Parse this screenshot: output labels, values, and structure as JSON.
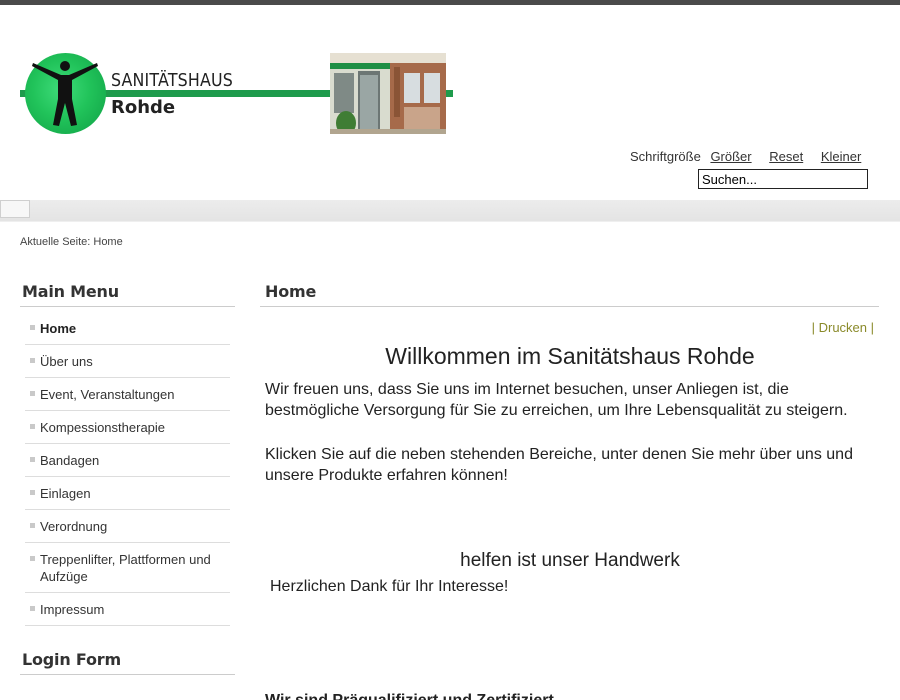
{
  "logo": {
    "title": "SANITÄTSHAUS",
    "subtitle": "Rohde",
    "brand_color": "#1e9b4c"
  },
  "font_size": {
    "label": "Schriftgröße",
    "bigger": "Größer",
    "reset": "Reset",
    "smaller": "Kleiner"
  },
  "search": {
    "placeholder": "Suchen..."
  },
  "breadcrumb": {
    "text": "Aktuelle Seite: Home"
  },
  "sidebar": {
    "main_menu_title": "Main Menu",
    "items": [
      {
        "label": "Home"
      },
      {
        "label": "Über uns"
      },
      {
        "label": "Event, Veranstaltungen"
      },
      {
        "label": "Kompessionstherapie"
      },
      {
        "label": "Bandagen"
      },
      {
        "label": "Einlagen"
      },
      {
        "label": "Verordnung"
      },
      {
        "label": "Treppenlifter, Plattformen und Aufzüge"
      },
      {
        "label": "Impressum"
      }
    ],
    "login_title": "Login Form"
  },
  "main": {
    "title": "Home",
    "print_label": "| Drucken |",
    "print_color": "#8a8a2a",
    "welcome": "Willkommen im Sanitätshaus Rohde",
    "paragraph_1": "Wir freuen uns, dass Sie uns im Internet besuchen, unser Anliegen ist, die bestmögliche Versorgung für Sie zu erreichen, um Ihre Lebensqualität zu steigern.",
    "paragraph_2": "Klicken Sie auf die neben stehenden Bereiche, unter denen Sie mehr über uns und unsere Produkte erfahren können!",
    "slogan": "helfen ist unser Handwerk",
    "thanks": "Herzlichen Dank für Ihr Interesse!",
    "next_heading": "Wir sind Präqualifiziert und Zertifiziert"
  }
}
